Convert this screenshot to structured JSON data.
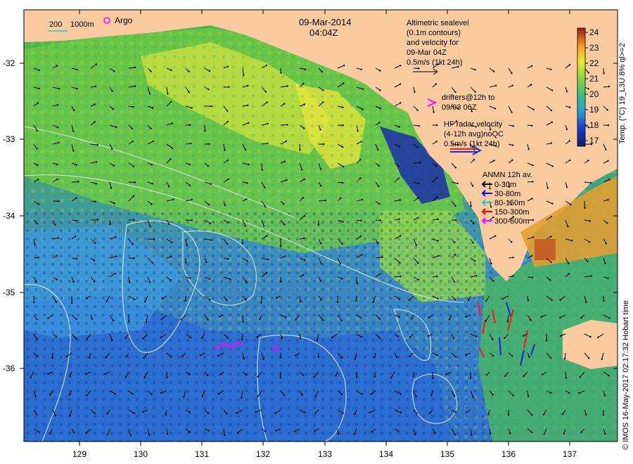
{
  "date_line": "09-Mar-2014",
  "time_line": "04:04Z",
  "scale_bar": {
    "depth1": "200",
    "depth2": "1000m"
  },
  "argo_label": "Argo",
  "altimetry_note": [
    "Altimetric sealevel",
    "(0.1m contours)",
    "and velocity for",
    "09-Mar 04Z",
    "0.5m/s (1kt 24h)"
  ],
  "drifters_note": [
    "drifters@12h to",
    "09/03 06Z"
  ],
  "hf_radar_note": [
    "HF radar velocity",
    "(4-12h avg)noQC",
    "0.5m/s (1kt 24h)"
  ],
  "anmn": {
    "title": "ANMN 12h av.",
    "entries": [
      {
        "label": "0-30m",
        "color": "#000000"
      },
      {
        "label": "30-80m",
        "color": "#0000ee"
      },
      {
        "label": "80-150m",
        "color": "#22cccc"
      },
      {
        "label": "150-300m",
        "color": "#ee0000"
      },
      {
        "label": "300-600m",
        "color": "#ff00ff"
      }
    ]
  },
  "colorbar": {
    "title": "Temp. (°C) 19_L3U 8% ql>=2",
    "ticks": [
      "24",
      "23",
      "22",
      "21",
      "20",
      "19",
      "18",
      "17"
    ]
  },
  "credit": "© IMOS 16-May-2017 02:17:32 Hobart time",
  "lat_ticks": [
    "-32",
    "-33",
    "-34",
    "-35",
    "-36"
  ],
  "lon_ticks": [
    "129",
    "130",
    "131",
    "132",
    "133",
    "134",
    "135",
    "136",
    "137"
  ],
  "colors": {
    "land": "#facba0",
    "contour": "#d8f0e8",
    "drifter": "#ff00ff"
  }
}
